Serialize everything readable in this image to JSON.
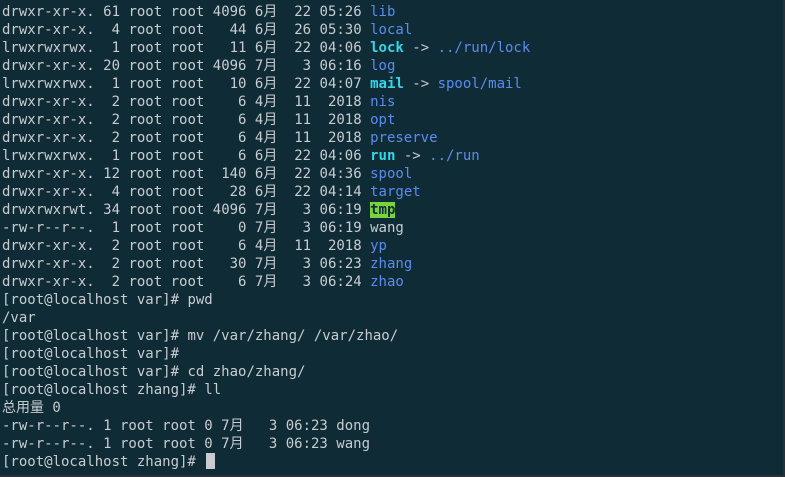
{
  "listing": [
    {
      "perm": "drwxr-xr-x.",
      "links": "61",
      "owner": "root",
      "group": "root",
      "size": "4096",
      "month": "6月",
      "day": "22",
      "time": "05:26",
      "name": "lib",
      "type": "dir"
    },
    {
      "perm": "drwxr-xr-x.",
      "links": "4",
      "owner": "root",
      "group": "root",
      "size": "44",
      "month": "6月",
      "day": "26",
      "time": "05:30",
      "name": "local",
      "type": "dir"
    },
    {
      "perm": "lrwxrwxrwx.",
      "links": "1",
      "owner": "root",
      "group": "root",
      "size": "11",
      "month": "6月",
      "day": "22",
      "time": "04:06",
      "name": "lock",
      "type": "link",
      "arrow": "->",
      "target": "../run/lock"
    },
    {
      "perm": "drwxr-xr-x.",
      "links": "20",
      "owner": "root",
      "group": "root",
      "size": "4096",
      "month": "7月",
      "day": "3",
      "time": "06:16",
      "name": "log",
      "type": "dir"
    },
    {
      "perm": "lrwxrwxrwx.",
      "links": "1",
      "owner": "root",
      "group": "root",
      "size": "10",
      "month": "6月",
      "day": "22",
      "time": "04:07",
      "name": "mail",
      "type": "link",
      "arrow": "->",
      "target": "spool/mail"
    },
    {
      "perm": "drwxr-xr-x.",
      "links": "2",
      "owner": "root",
      "group": "root",
      "size": "6",
      "month": "4月",
      "day": "11",
      "time": "2018",
      "name": "nis",
      "type": "dir"
    },
    {
      "perm": "drwxr-xr-x.",
      "links": "2",
      "owner": "root",
      "group": "root",
      "size": "6",
      "month": "4月",
      "day": "11",
      "time": "2018",
      "name": "opt",
      "type": "dir"
    },
    {
      "perm": "drwxr-xr-x.",
      "links": "2",
      "owner": "root",
      "group": "root",
      "size": "6",
      "month": "4月",
      "day": "11",
      "time": "2018",
      "name": "preserve",
      "type": "dir"
    },
    {
      "perm": "lrwxrwxrwx.",
      "links": "1",
      "owner": "root",
      "group": "root",
      "size": "6",
      "month": "6月",
      "day": "22",
      "time": "04:06",
      "name": "run",
      "type": "link",
      "arrow": "->",
      "target": "../run"
    },
    {
      "perm": "drwxr-xr-x.",
      "links": "12",
      "owner": "root",
      "group": "root",
      "size": "140",
      "month": "6月",
      "day": "22",
      "time": "04:36",
      "name": "spool",
      "type": "dir"
    },
    {
      "perm": "drwxr-xr-x.",
      "links": "4",
      "owner": "root",
      "group": "root",
      "size": "28",
      "month": "6月",
      "day": "22",
      "time": "04:14",
      "name": "target",
      "type": "dir"
    },
    {
      "perm": "drwxrwxrwt.",
      "links": "34",
      "owner": "root",
      "group": "root",
      "size": "4096",
      "month": "7月",
      "day": "3",
      "time": "06:19",
      "name": "tmp",
      "type": "sticky"
    },
    {
      "perm": "-rw-r--r--.",
      "links": "1",
      "owner": "root",
      "group": "root",
      "size": "0",
      "month": "7月",
      "day": "3",
      "time": "06:19",
      "name": "wang",
      "type": "file"
    },
    {
      "perm": "drwxr-xr-x.",
      "links": "2",
      "owner": "root",
      "group": "root",
      "size": "6",
      "month": "4月",
      "day": "11",
      "time": "2018",
      "name": "yp",
      "type": "dir"
    },
    {
      "perm": "drwxr-xr-x.",
      "links": "2",
      "owner": "root",
      "group": "root",
      "size": "30",
      "month": "7月",
      "day": "3",
      "time": "06:23",
      "name": "zhang",
      "type": "dir"
    },
    {
      "perm": "drwxr-xr-x.",
      "links": "2",
      "owner": "root",
      "group": "root",
      "size": "6",
      "month": "7月",
      "day": "3",
      "time": "06:24",
      "name": "zhao",
      "type": "dir"
    }
  ],
  "session": [
    {
      "kind": "prompt",
      "prompt": "[root@localhost var]# ",
      "command": "pwd"
    },
    {
      "kind": "output",
      "text": "/var"
    },
    {
      "kind": "prompt",
      "prompt": "[root@localhost var]# ",
      "command": "mv /var/zhang/ /var/zhao/"
    },
    {
      "kind": "prompt",
      "prompt": "[root@localhost var]# ",
      "command": ""
    },
    {
      "kind": "prompt",
      "prompt": "[root@localhost var]# ",
      "command": "cd zhao/zhang/"
    },
    {
      "kind": "prompt",
      "prompt": "[root@localhost zhang]# ",
      "command": "ll"
    },
    {
      "kind": "output",
      "text": "总用量 0"
    },
    {
      "kind": "output",
      "text": "-rw-r--r--. 1 root root 0 7月   3 06:23 dong"
    },
    {
      "kind": "output",
      "text": "-rw-r--r--. 1 root root 0 7月   3 06:23 wang"
    },
    {
      "kind": "active",
      "prompt": "[root@localhost zhang]# ",
      "command": ""
    }
  ],
  "colors": {
    "background": "#0f2c36",
    "text": "#c8ccd0",
    "directory": "#5a8cf0",
    "symlink": "#30d8e8",
    "sticky_bg": "#79d43b"
  }
}
